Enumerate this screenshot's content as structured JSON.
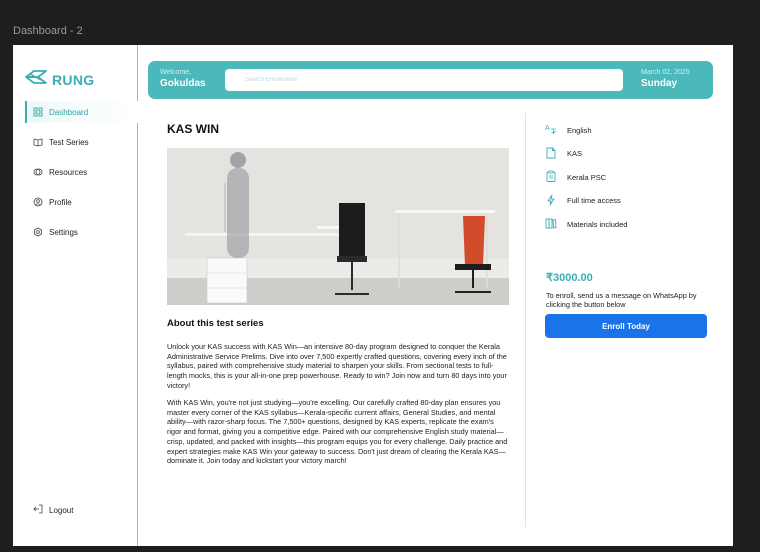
{
  "frame_label": "Dashboard - 2",
  "brand": {
    "name": "RUNG",
    "accent_color": "#3aaeb4"
  },
  "sidebar": {
    "items": [
      {
        "label": "Dashboard",
        "icon": "grid-icon",
        "active": true
      },
      {
        "label": "Test Series",
        "icon": "book-icon",
        "active": false
      },
      {
        "label": "Resources",
        "icon": "layers-icon",
        "active": false
      },
      {
        "label": "Profile",
        "icon": "user-icon",
        "active": false
      },
      {
        "label": "Settings",
        "icon": "gear-icon",
        "active": false
      }
    ],
    "logout_label": "Logout"
  },
  "header": {
    "welcome_label": "Welcome,",
    "user_name": "Gokuldas",
    "search_placeholder": "Search Enrollments",
    "date": "March 02, 2025",
    "day": "Sunday"
  },
  "course": {
    "title": "KAS WIN",
    "about_heading": "About this test series",
    "paragraphs": [
      "Unlock your KAS success with KAS Win—an intensive 80-day program designed to conquer the Kerala Administrative Service Prelims. Dive into over 7,500 expertly crafted questions, covering every inch of the syllabus, paired with comprehensive study material to sharpen your skills. From sectional tests to full-length mocks, this is your all-in-one prep powerhouse. Ready to win? Join now and turn 80 days into your victory!",
      "With KAS Win, you're not just studying—you're excelling. Our carefully crafted 80-day plan ensures you master every corner of the KAS syllabus—Kerala-specific current affairs, General Studies, and mental ability—with razor-sharp focus. The 7,500+ questions, designed by KAS experts, replicate the exam's rigor and format, giving you a competitive edge. Paired with our comprehensive English study material—crisp, updated, and packed with insights—this program equips you for every challenge. Daily practice and expert strategies make KAS Win your gateway to success. Don't just dream of clearing the Kerala KAS—dominate it. Join today and kickstart your victory march!"
    ]
  },
  "features": [
    {
      "label": "English",
      "icon": "language-icon"
    },
    {
      "label": "KAS",
      "icon": "document-icon"
    },
    {
      "label": "Kerala PSC",
      "icon": "clipboard-icon"
    },
    {
      "label": "Full time access",
      "icon": "lightning-icon"
    },
    {
      "label": "Materials included",
      "icon": "books-icon"
    }
  ],
  "pricing": {
    "price": "₹3000.00",
    "note": "To enroll, send us a message on WhatsApp by clicking the button below",
    "button_label": "Enroll Today",
    "button_color": "#1a73e8"
  }
}
